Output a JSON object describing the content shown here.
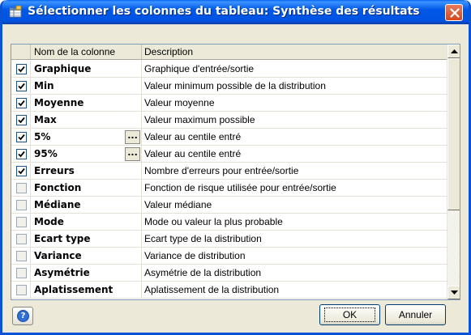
{
  "window": {
    "title": "Sélectionner les colonnes du tableau: Synthèse des résultats",
    "title_icon": "table-columns-icon",
    "close_icon": "close-icon",
    "accent_color": "#0054e3",
    "close_color": "#d5471f"
  },
  "grid": {
    "headers": {
      "name": "Nom de la colonne",
      "description": "Description"
    },
    "rows": [
      {
        "name": "Graphique",
        "description": "Graphique d'entrée/sortie",
        "checked": true,
        "ellipsis": ""
      },
      {
        "name": "Min",
        "description": "Valeur minimum possible de la distribution",
        "checked": true,
        "ellipsis": ""
      },
      {
        "name": "Moyenne",
        "description": "Valeur moyenne",
        "checked": true,
        "ellipsis": ""
      },
      {
        "name": "Max",
        "description": "Valeur maximum possible",
        "checked": true,
        "ellipsis": ""
      },
      {
        "name": "5%",
        "description": "Valeur au centile entré",
        "checked": true,
        "ellipsis": "..."
      },
      {
        "name": "95%",
        "description": "Valeur au centile entré",
        "checked": true,
        "ellipsis": "..."
      },
      {
        "name": "Erreurs",
        "description": "Nombre d'erreurs pour entrée/sortie",
        "checked": true,
        "ellipsis": ""
      },
      {
        "name": "Fonction",
        "description": "Fonction de risque utilisée pour entrée/sortie",
        "checked": false,
        "ellipsis": ""
      },
      {
        "name": "Médiane",
        "description": "Valeur médiane",
        "checked": false,
        "ellipsis": ""
      },
      {
        "name": "Mode",
        "description": "Mode ou valeur la plus probable",
        "checked": false,
        "ellipsis": ""
      },
      {
        "name": "Ecart type",
        "description": "Ecart type de la distribution",
        "checked": false,
        "ellipsis": ""
      },
      {
        "name": "Variance",
        "description": "Variance de distribution",
        "checked": false,
        "ellipsis": ""
      },
      {
        "name": "Asymétrie",
        "description": "Asymétrie de la distribution",
        "checked": false,
        "ellipsis": ""
      },
      {
        "name": "Aplatissement",
        "description": "Aplatissement de la distribution",
        "checked": false,
        "ellipsis": ""
      }
    ],
    "scroll_position": 0
  },
  "footer": {
    "help_icon": "help-icon",
    "ok_label": "OK",
    "cancel_label": "Annuler"
  }
}
